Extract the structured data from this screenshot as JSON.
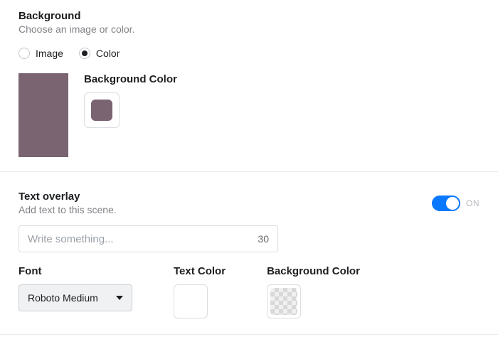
{
  "background": {
    "title": "Background",
    "subtitle": "Choose an image or color.",
    "options": {
      "image": "Image",
      "color": "Color"
    },
    "selected": "color",
    "color_label": "Background Color",
    "color_value": "#7a6471"
  },
  "text_overlay": {
    "title": "Text overlay",
    "subtitle": "Add text to this scene.",
    "enabled": true,
    "toggle_on_label": "ON",
    "input_placeholder": "Write something...",
    "input_value": "",
    "char_limit": "30",
    "font_label": "Font",
    "font_value": "Roboto Medium",
    "text_color_label": "Text Color",
    "text_color_value": "#ffffff",
    "bg_color_label": "Background Color",
    "bg_color_value": "transparent"
  }
}
